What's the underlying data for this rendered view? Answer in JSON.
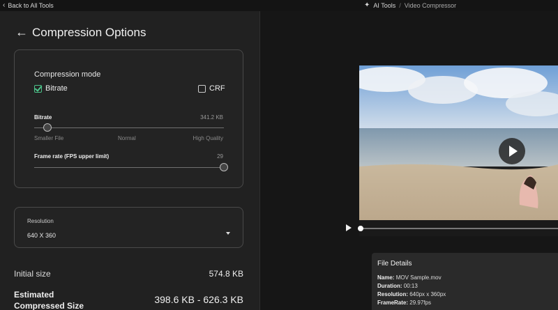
{
  "topbar": {
    "back_label": "Back to All Tools",
    "crumb_root": "AI Tools",
    "crumb_sep": "/",
    "crumb_current": "Video Compressor"
  },
  "panel": {
    "title": "Compression Options",
    "mode": {
      "label": "Compression mode",
      "options": [
        {
          "label": "Bitrate",
          "checked": true
        },
        {
          "label": "CRF",
          "checked": false
        }
      ]
    },
    "bitrate": {
      "label": "Bitrate",
      "value": "341.2 KB",
      "level": 0.07,
      "ticks": [
        "Smaller File",
        "Normal",
        "High Quality"
      ]
    },
    "framerate": {
      "label": "Frame rate (FPS upper limit)",
      "value": "29",
      "level": 1.0
    },
    "resolution": {
      "label": "Resolution",
      "value": "640 X 360"
    },
    "initial": {
      "label": "Initial size",
      "value": "574.8 KB"
    },
    "estimated": {
      "label": "Estimated Compressed Size",
      "value": "398.6 KB - 626.3 KB"
    }
  },
  "file_details": {
    "title": "File Details",
    "rows": [
      {
        "key": "Name:",
        "value": "MOV Sample.mov"
      },
      {
        "key": "Duration:",
        "value": "00:13"
      },
      {
        "key": "Resolution:",
        "value": "640px x 360px"
      },
      {
        "key": "FrameRate:",
        "value": "29.97fps"
      }
    ]
  },
  "player": {
    "progress": 0.0
  },
  "colors": {
    "accent": "#4cc38a",
    "panel": "#212121",
    "background": "#161616"
  }
}
